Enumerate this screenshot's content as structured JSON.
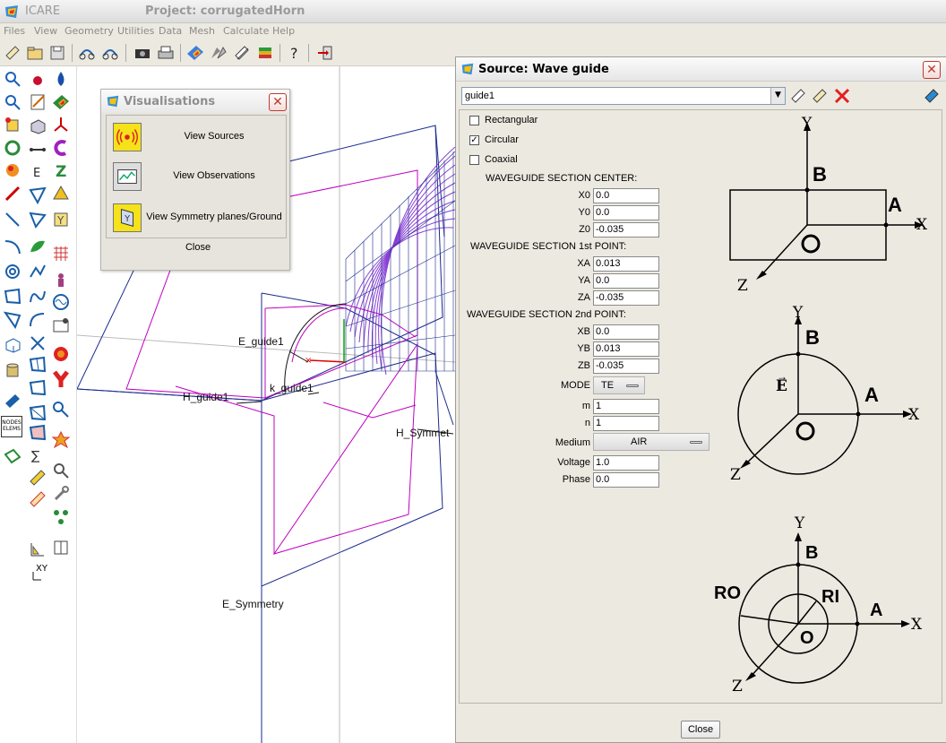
{
  "titlebar": {
    "app_title": "ICARE",
    "project_title": "Project: corrugatedHorn"
  },
  "menu": [
    "Files",
    "View",
    "Geometry",
    "Utilities",
    "Data",
    "Mesh",
    "Calculate",
    "Help"
  ],
  "palette": {
    "nodes_label": "NODES ELEMS",
    "xy_label": "XY"
  },
  "canvas": {
    "labels": {
      "e_guide": "E_guide1",
      "h_guide": "H_guide1",
      "k_guide": "k_guide1",
      "h_symmetry": "H_Symmet",
      "e_symmetry": "E_Symmetry"
    }
  },
  "visualisations": {
    "title": "Visualisations",
    "items": [
      {
        "label": "View Sources",
        "icon": "source-icon"
      },
      {
        "label": "View Observations",
        "icon": "observation-icon"
      },
      {
        "label": "View Symmetry planes/Ground",
        "icon": "symmetry-icon"
      }
    ],
    "close": "Close"
  },
  "source": {
    "title": "Source: Wave guide",
    "name": "guide1",
    "types": [
      {
        "label": "Rectangular",
        "checked": false
      },
      {
        "label": "Circular",
        "checked": true
      },
      {
        "label": "Coaxial",
        "checked": false
      }
    ],
    "center_header": "WAVEGUIDE SECTION  CENTER:",
    "p1_header": "WAVEGUIDE SECTION 1st  POINT:",
    "p2_header": "WAVEGUIDE SECTION 2nd  POINT:",
    "fields": {
      "x0": {
        "label": "X0",
        "value": "0.0"
      },
      "y0": {
        "label": "Y0",
        "value": "0.0"
      },
      "z0": {
        "label": "Z0",
        "value": "-0.035"
      },
      "xa": {
        "label": "XA",
        "value": "0.013"
      },
      "ya": {
        "label": "YA",
        "value": "0.0"
      },
      "za": {
        "label": "ZA",
        "value": "-0.035"
      },
      "xb": {
        "label": "XB",
        "value": "0.0"
      },
      "yb": {
        "label": "YB",
        "value": "0.013"
      },
      "zb": {
        "label": "ZB",
        "value": "-0.035"
      },
      "m": {
        "label": "m",
        "value": "1"
      },
      "n": {
        "label": "n",
        "value": "1"
      },
      "voltage": {
        "label": "Voltage",
        "value": "1.0"
      },
      "phase": {
        "label": "Phase",
        "value": "0.0"
      }
    },
    "mode": {
      "label": "MODE",
      "value": "TE"
    },
    "medium": {
      "label": "Medium",
      "value": "AIR"
    },
    "close": "Close",
    "diagram_labels": {
      "x": "X",
      "y": "Y",
      "z": "Z",
      "a": "A",
      "b": "B",
      "o": "O",
      "e": "E",
      "ro": "RO",
      "ri": "RI"
    }
  }
}
